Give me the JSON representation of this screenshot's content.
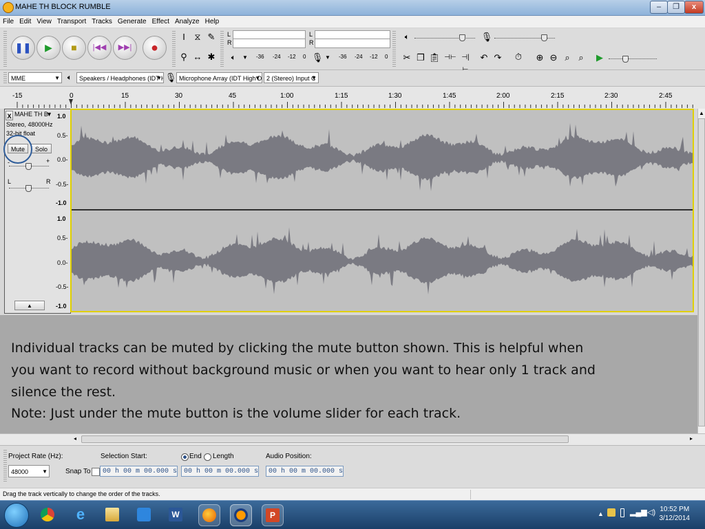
{
  "window": {
    "title": "MAHE TH BLOCK RUMBLE"
  },
  "menu": [
    "File",
    "Edit",
    "View",
    "Transport",
    "Tracks",
    "Generate",
    "Effect",
    "Analyze",
    "Help"
  ],
  "transport_icons": [
    "pause-icon",
    "play-icon",
    "stop-icon",
    "skip-start-icon",
    "skip-end-icon",
    "record-icon"
  ],
  "meters": {
    "playback_channels": [
      "L",
      "R"
    ],
    "record_channels": [
      "L",
      "R"
    ],
    "scale_play": [
      "-36",
      "-24",
      "-12",
      "0"
    ],
    "scale_rec": [
      "-36",
      "-24",
      "-12",
      "0"
    ]
  },
  "devices": {
    "host": "MME",
    "output": "Speakers / Headphones (IDT H",
    "input": "Microphone Array (IDT High De",
    "channels": "2 (Stereo) Input C"
  },
  "ruler": [
    "-15",
    "0",
    "15",
    "30",
    "45",
    "1:00",
    "1:15",
    "1:30",
    "1:45",
    "2:00",
    "2:15",
    "2:30",
    "2:45"
  ],
  "track": {
    "name": "MAHE TH B",
    "info1": "Stereo, 48000Hz",
    "info2": "32-bit float",
    "mute": "Mute",
    "solo": "Solo",
    "gain_minus": "-",
    "gain_plus": "+",
    "pan_left": "L",
    "pan_right": "R",
    "close": "X",
    "menu_arrow": "▼",
    "collapse": "▲"
  },
  "vscale": [
    "1.0",
    "0.5-",
    "0.0-",
    "-0.5-",
    "-1.0"
  ],
  "caption": {
    "line1": "Individual tracks can be muted by clicking the mute button shown.  This is helpful when",
    "line2": "you want to record without background music or when you want to hear only 1 track and",
    "line3": "silence the rest.",
    "line4": "Note: Just under the mute button is the volume slider for each track."
  },
  "selection": {
    "project_rate_label": "Project Rate (Hz):",
    "project_rate": "48000",
    "snap_to": "Snap To",
    "selection_start_label": "Selection Start:",
    "end_label": "End",
    "length_label": "Length",
    "audio_position_label": "Audio Position:",
    "start_time": "00 h 00 m 00.000 s",
    "end_time": "00 h 00 m 00.000 s",
    "audio_position": "00 h 00 m 00.000 s"
  },
  "status": "Drag the track vertically to change the order of the tracks.",
  "clock": {
    "time": "10:52 PM",
    "date": "3/12/2014"
  },
  "colors": {
    "waveform": "#7a7a82",
    "wave_bg": "#c0c0c0",
    "selection_border": "#e0d000",
    "annotation_circle": "#2f5d9a"
  }
}
